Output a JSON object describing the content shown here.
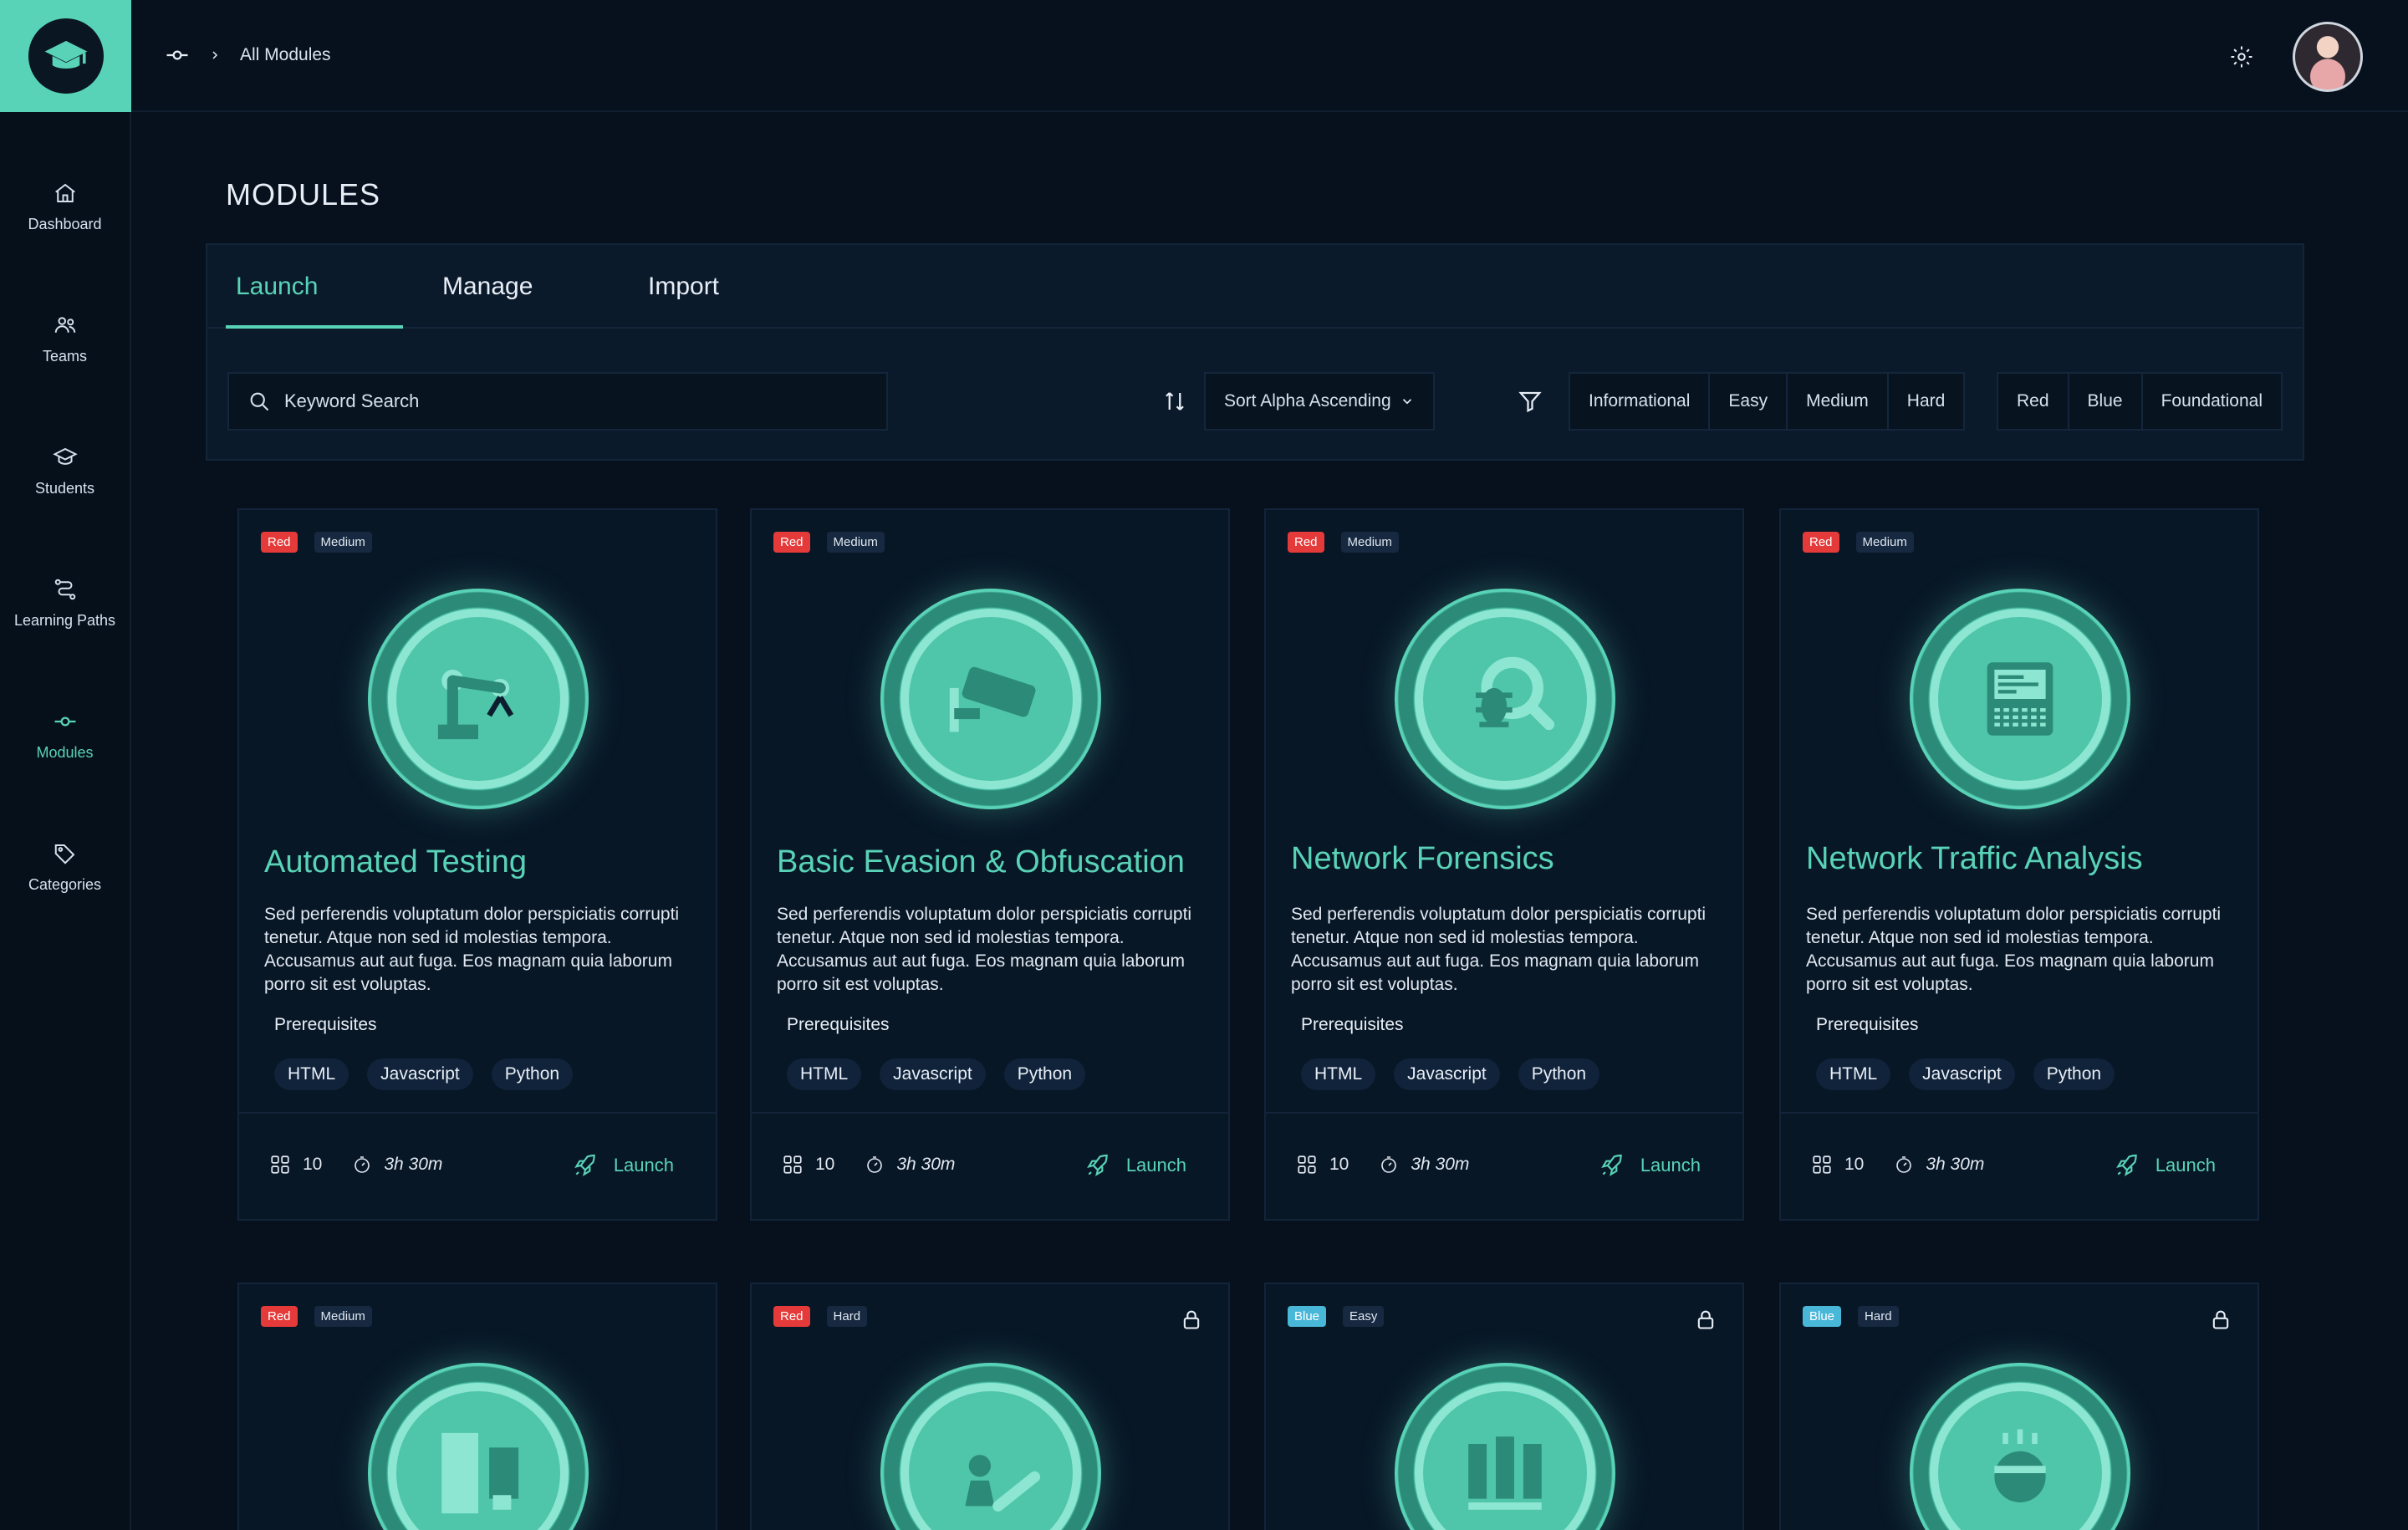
{
  "breadcrumb": {
    "current": "All Modules"
  },
  "sidebar": {
    "items": [
      {
        "label": "Dashboard"
      },
      {
        "label": "Teams"
      },
      {
        "label": "Students"
      },
      {
        "label": "Learning Paths"
      },
      {
        "label": "Modules"
      },
      {
        "label": "Categories"
      }
    ]
  },
  "page": {
    "title": "MODULES"
  },
  "tabs": [
    {
      "label": "Launch"
    },
    {
      "label": "Manage"
    },
    {
      "label": "Import"
    }
  ],
  "toolbar": {
    "search_placeholder": "Keyword Search",
    "sort_label": "Sort Alpha Ascending",
    "difficulty_filters": [
      "Informational",
      "Easy",
      "Medium",
      "Hard"
    ],
    "team_filters": [
      "Red",
      "Blue",
      "Foundational"
    ]
  },
  "cards": [
    {
      "tags": [
        "Red",
        "Medium"
      ],
      "title": "Automated Testing",
      "description": "Sed perferendis voluptatum dolor perspiciatis corrupti tenetur. Atque non sed id molestias tempora. Accusamus aut aut fuga. Eos magnam quia laborum porro sit est voluptas.",
      "prereq_label": "Prerequisites",
      "prereqs": [
        "HTML",
        "Javascript",
        "Python"
      ],
      "count": "10",
      "duration": "3h 30m",
      "action": "Launch"
    },
    {
      "tags": [
        "Red",
        "Medium"
      ],
      "title": "Basic Evasion & Obfuscation",
      "description": "Sed perferendis voluptatum dolor perspiciatis corrupti tenetur. Atque non sed id molestias tempora. Accusamus aut aut fuga. Eos magnam quia laborum porro sit est voluptas.",
      "prereq_label": "Prerequisites",
      "prereqs": [
        "HTML",
        "Javascript",
        "Python"
      ],
      "count": "10",
      "duration": "3h 30m",
      "action": "Launch"
    },
    {
      "tags": [
        "Red",
        "Medium"
      ],
      "title": "Network Forensics",
      "description": "Sed perferendis voluptatum dolor perspiciatis corrupti tenetur. Atque non sed id molestias tempora. Accusamus aut aut fuga. Eos magnam quia laborum porro sit est voluptas.",
      "prereq_label": "Prerequisites",
      "prereqs": [
        "HTML",
        "Javascript",
        "Python"
      ],
      "count": "10",
      "duration": "3h 30m",
      "action": "Launch"
    },
    {
      "tags": [
        "Red",
        "Medium"
      ],
      "title": "Network Traffic Analysis",
      "description": "Sed perferendis voluptatum dolor perspiciatis corrupti tenetur. Atque non sed id molestias tempora. Accusamus aut aut fuga. Eos magnam quia laborum porro sit est voluptas.",
      "prereq_label": "Prerequisites",
      "prereqs": [
        "HTML",
        "Javascript",
        "Python"
      ],
      "count": "10",
      "duration": "3h 30m",
      "action": "Launch"
    },
    {
      "tags": [
        "Red",
        "Medium"
      ],
      "locked": false
    },
    {
      "tags": [
        "Red",
        "Hard"
      ],
      "locked": true
    },
    {
      "tags": [
        "Blue",
        "Easy"
      ],
      "locked": true
    },
    {
      "tags": [
        "Blue",
        "Hard"
      ],
      "locked": true
    }
  ],
  "colors": {
    "accent": "#59d3b7",
    "tag_red": "#e53a3a",
    "tag_blue": "#49b7d8",
    "background": "#07111d"
  }
}
